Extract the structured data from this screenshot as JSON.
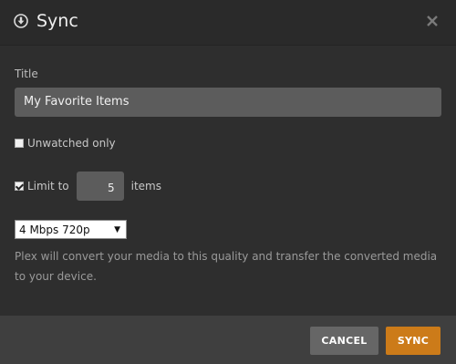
{
  "dialog": {
    "title": "Sync",
    "icons": {
      "header": "download-circle-icon",
      "close": "close-icon"
    }
  },
  "form": {
    "title_label": "Title",
    "title_value": "My Favorite Items",
    "unwatched_label": "Unwatched only",
    "unwatched_checked": false,
    "limit_prefix": "Limit to",
    "limit_value": "5",
    "limit_suffix": "items",
    "limit_checked": true,
    "quality_selected": "4 Mbps 720p",
    "help_text": "Plex will convert your media to this quality and transfer the converted media to your device."
  },
  "footer": {
    "cancel_label": "CANCEL",
    "sync_label": "SYNC"
  },
  "colors": {
    "accent": "#cc7b19",
    "cancel_button": "#666666",
    "dialog_background": "#2e2e2e",
    "input_background": "#5c5c5c"
  }
}
